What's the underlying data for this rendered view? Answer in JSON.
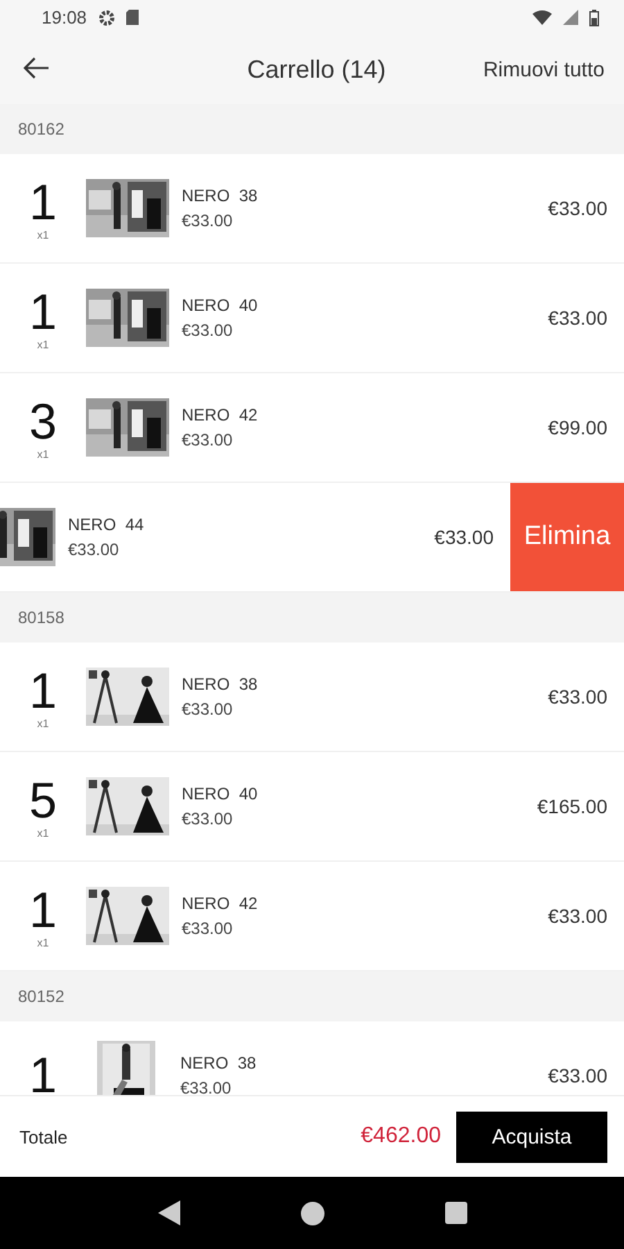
{
  "status_bar": {
    "time": "19:08"
  },
  "app_bar": {
    "title": "Carrello (14)",
    "action": "Rimuovi tutto"
  },
  "groups": [
    {
      "code": "80162",
      "items": [
        {
          "quantity": "1",
          "multiplier": "x1",
          "name": "NERO  38",
          "unit_price": "€33.00",
          "total": "€33.00",
          "swiped": false
        },
        {
          "quantity": "1",
          "multiplier": "x1",
          "name": "NERO  40",
          "unit_price": "€33.00",
          "total": "€33.00",
          "swiped": false
        },
        {
          "quantity": "3",
          "multiplier": "x1",
          "name": "NERO  42",
          "unit_price": "€33.00",
          "total": "€99.00",
          "swiped": false
        },
        {
          "name": "NERO  44",
          "unit_price": "€33.00",
          "total": "€33.00",
          "swiped": true,
          "delete_label": "Elimina"
        }
      ]
    },
    {
      "code": "80158",
      "items": [
        {
          "quantity": "1",
          "multiplier": "x1",
          "name": "NERO  38",
          "unit_price": "€33.00",
          "total": "€33.00",
          "swiped": false
        },
        {
          "quantity": "5",
          "multiplier": "x1",
          "name": "NERO  40",
          "unit_price": "€33.00",
          "total": "€165.00",
          "swiped": false
        },
        {
          "quantity": "1",
          "multiplier": "x1",
          "name": "NERO  42",
          "unit_price": "€33.00",
          "total": "€33.00",
          "swiped": false
        }
      ]
    },
    {
      "code": "80152",
      "items": [
        {
          "quantity": "1",
          "name": "NERO  38",
          "unit_price": "€33.00",
          "total": "€33.00",
          "swiped": false
        }
      ]
    }
  ],
  "footer": {
    "label": "Totale",
    "total": "€462.00",
    "button": "Acquista"
  }
}
